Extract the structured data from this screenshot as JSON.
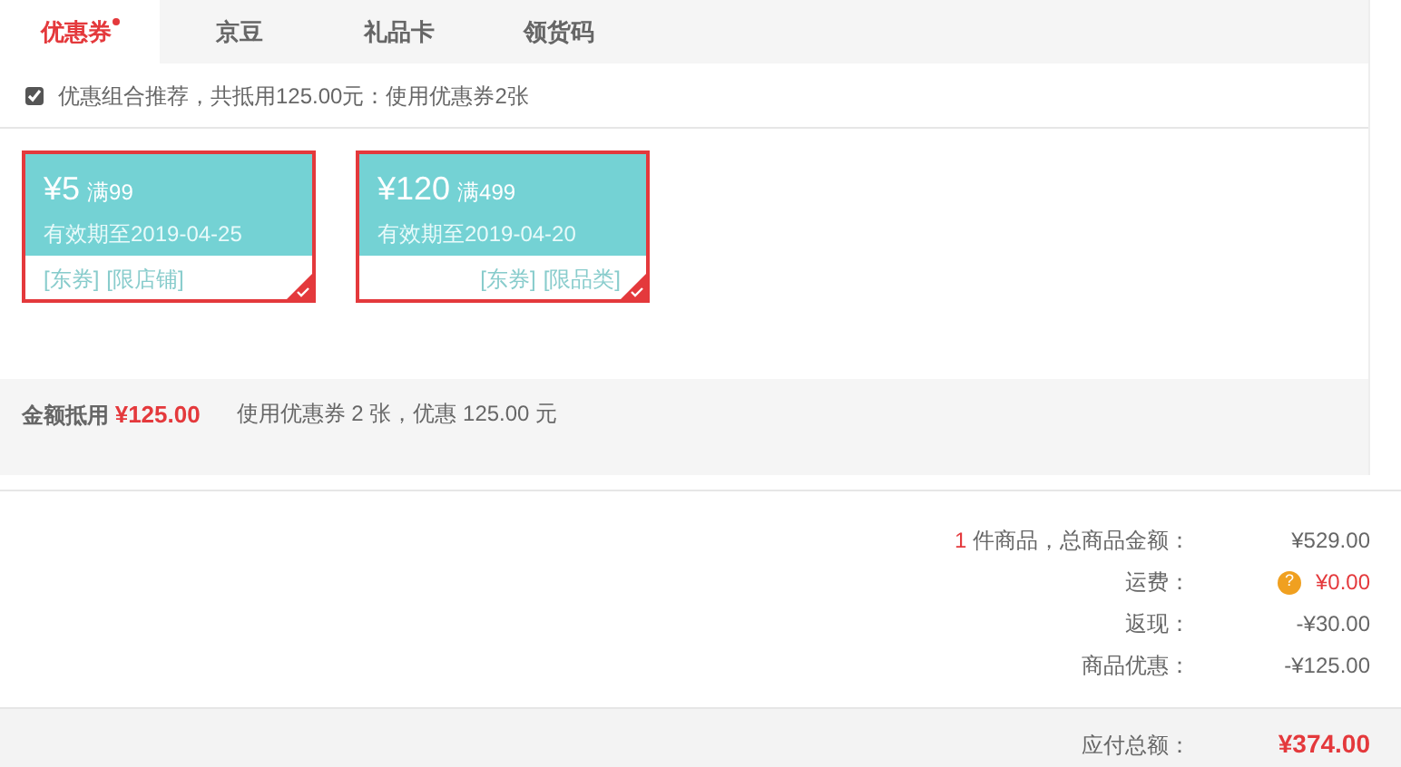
{
  "tabs": [
    {
      "label": "优惠券",
      "selected": true,
      "dot": true
    },
    {
      "label": "京豆",
      "selected": false,
      "dot": false
    },
    {
      "label": "礼品卡",
      "selected": false,
      "dot": false
    },
    {
      "label": "领货码",
      "selected": false,
      "dot": false
    }
  ],
  "recommend": {
    "checked": true,
    "text": "优惠组合推荐，共抵用125.00元：使用优惠券2张"
  },
  "coupons": [
    {
      "amount": "¥5",
      "condition": "满99",
      "validity": "有效期至2019-04-25",
      "tags": [
        "[东券]",
        "[限店铺]"
      ],
      "selected": true
    },
    {
      "amount": "¥120",
      "condition": "满499",
      "validity": "有效期至2019-04-20",
      "tags": [
        "[东券]",
        "[限品类]"
      ],
      "selected": true
    }
  ],
  "deduction": {
    "label": "金额抵用",
    "amount": "¥125.00",
    "note": "使用优惠券 2 张，优惠 125.00 元"
  },
  "summary": [
    {
      "count": "1",
      "label": "件商品，总商品金额：",
      "value": "¥529.00",
      "kind": "plain"
    },
    {
      "label": "运费：",
      "value": "¥0.00",
      "kind": "help",
      "icon": "?"
    },
    {
      "label": "返现：",
      "value": "-¥30.00",
      "kind": "plain"
    },
    {
      "label": "商品优惠：",
      "value": "-¥125.00",
      "kind": "plain"
    }
  ],
  "total": {
    "label": "应付总额：",
    "value": "¥374.00"
  }
}
